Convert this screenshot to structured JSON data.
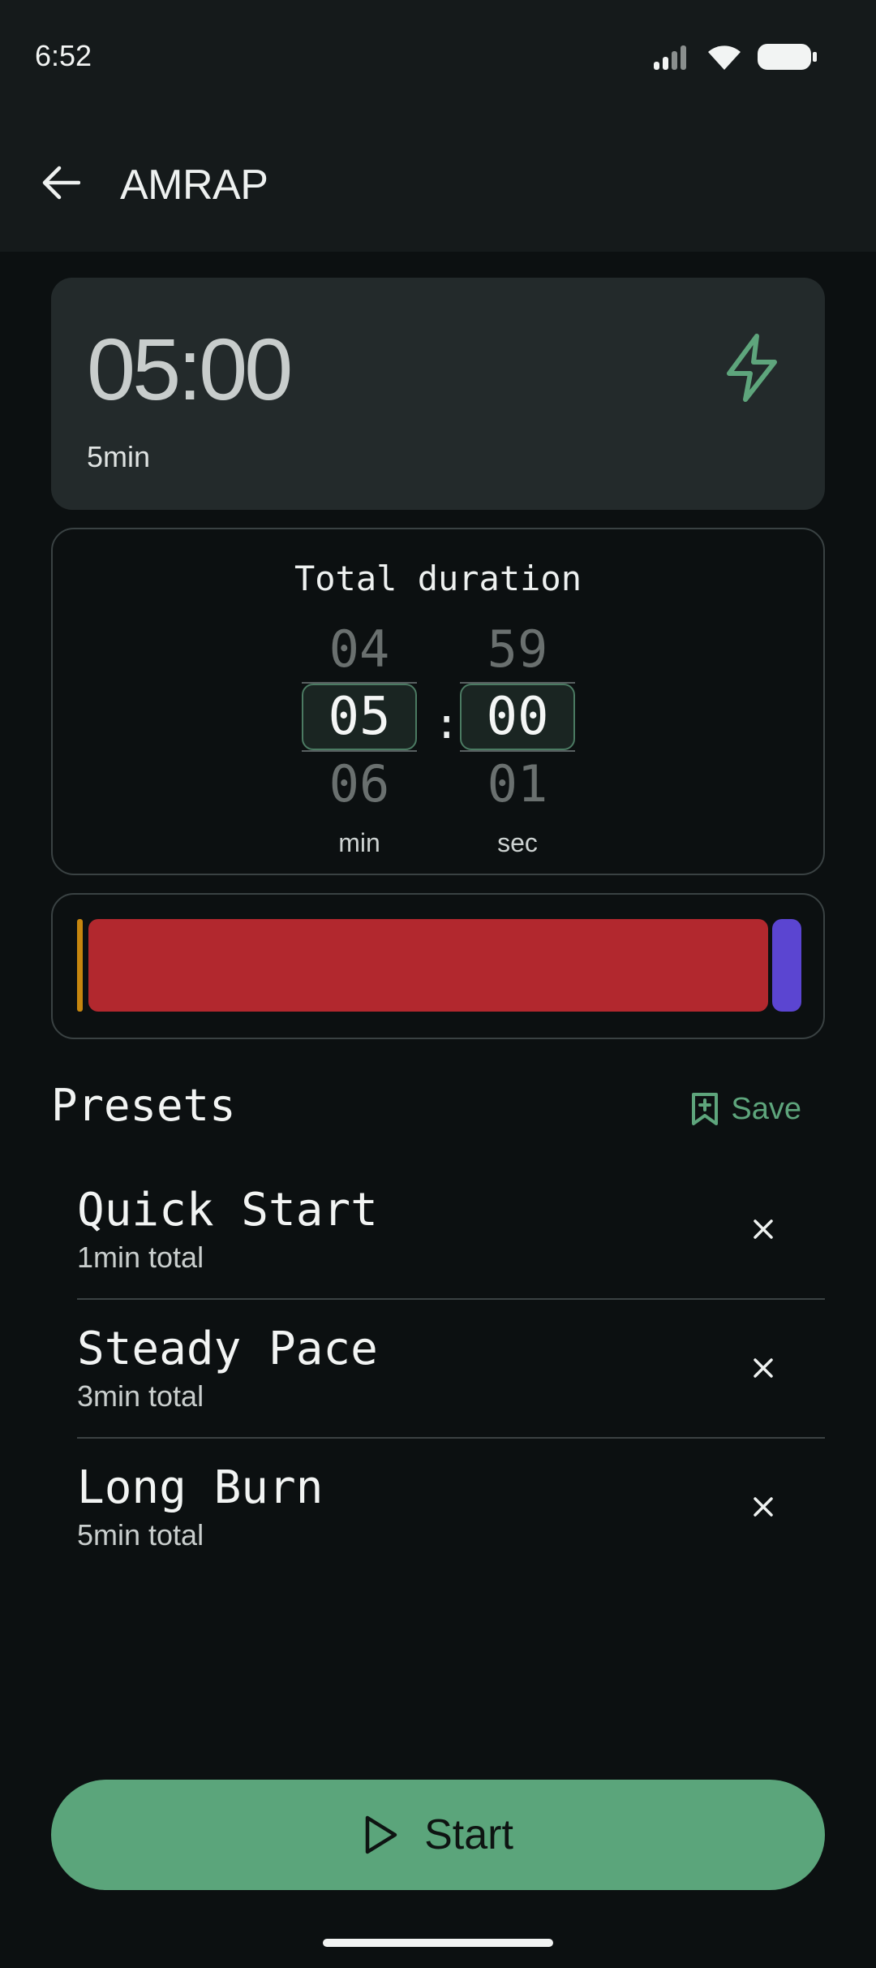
{
  "status_bar": {
    "time": "6:52"
  },
  "app_bar": {
    "title": "AMRAP"
  },
  "summary": {
    "time": "05:00",
    "subtitle": "5min"
  },
  "duration": {
    "title": "Total duration",
    "minutes": {
      "prev": "04",
      "selected": "05",
      "next": "06",
      "unit": "min"
    },
    "seconds": {
      "prev": "59",
      "selected": "00",
      "next": "01",
      "unit": "sec"
    },
    "separator": ":"
  },
  "phases": [
    {
      "color": "#c6860f"
    },
    {
      "color": "#b2282e"
    },
    {
      "color": "#5b45d1"
    }
  ],
  "presets": {
    "heading": "Presets",
    "save_label": "Save",
    "items": [
      {
        "name": "Quick Start",
        "total": "1min total"
      },
      {
        "name": "Steady Pace",
        "total": "3min total"
      },
      {
        "name": "Long Burn",
        "total": "5min total"
      }
    ]
  },
  "start_button": {
    "label": "Start"
  },
  "colors": {
    "accent": "#5ba57b",
    "background": "#0c1011",
    "card": "#232a2b"
  }
}
